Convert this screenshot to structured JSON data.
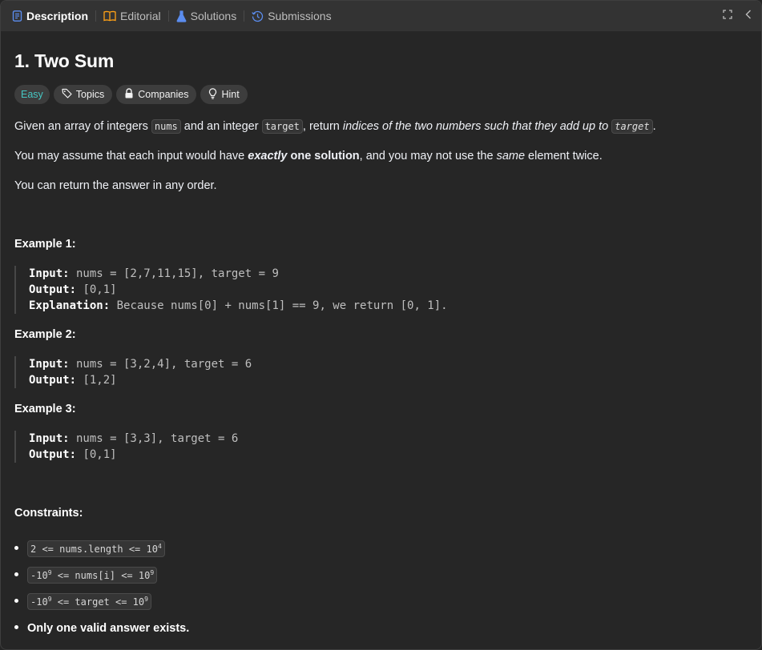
{
  "tabs": [
    {
      "label": "Description",
      "icon": "description-icon",
      "color": "#5b8def"
    },
    {
      "label": "Editorial",
      "icon": "book-icon",
      "color": "#ffa116"
    },
    {
      "label": "Solutions",
      "icon": "flask-icon",
      "color": "#5b8def"
    },
    {
      "label": "Submissions",
      "icon": "history-icon",
      "color": "#5b8def"
    }
  ],
  "problem": {
    "title": "1. Two Sum",
    "difficulty": "Easy",
    "chips": {
      "topics": "Topics",
      "companies": "Companies",
      "hint": "Hint"
    }
  },
  "description": {
    "p1": {
      "a": "Given an array of integers ",
      "code1": "nums",
      "b": " and an integer ",
      "code2": "target",
      "c": ", return ",
      "em": "indices of the two numbers such that they add up to",
      "d": " ",
      "code3": "target",
      "e": "."
    },
    "p2": {
      "a": "You may assume that each input would have ",
      "em_strong": "exactly",
      "strong": " one solution",
      "b": ", and you may not use the ",
      "em": "same",
      "c": " element twice."
    },
    "p3": "You can return the answer in any order."
  },
  "examples": [
    {
      "title": "Example 1:",
      "input_label": "Input:",
      "input": " nums = [2,7,11,15], target = 9",
      "output_label": "Output:",
      "output": " [0,1]",
      "explanation_label": "Explanation:",
      "explanation": " Because nums[0] + nums[1] == 9, we return [0, 1]."
    },
    {
      "title": "Example 2:",
      "input_label": "Input:",
      "input": " nums = [3,2,4], target = 6",
      "output_label": "Output:",
      "output": " [1,2]"
    },
    {
      "title": "Example 3:",
      "input_label": "Input:",
      "input": " nums = [3,3], target = 6",
      "output_label": "Output:",
      "output": " [0,1]"
    }
  ],
  "constraints": {
    "title": "Constraints:",
    "c1": {
      "text": "2 <= nums.length <= 10",
      "sup": "4"
    },
    "c2": {
      "pre": "-10",
      "pre_sup": "9",
      "mid": " <= nums[i] <= 10",
      "sup": "9"
    },
    "c3": {
      "pre": "-10",
      "pre_sup": "9",
      "mid": " <= target <= 10",
      "sup": "9"
    },
    "c4": "Only one valid answer exists."
  }
}
